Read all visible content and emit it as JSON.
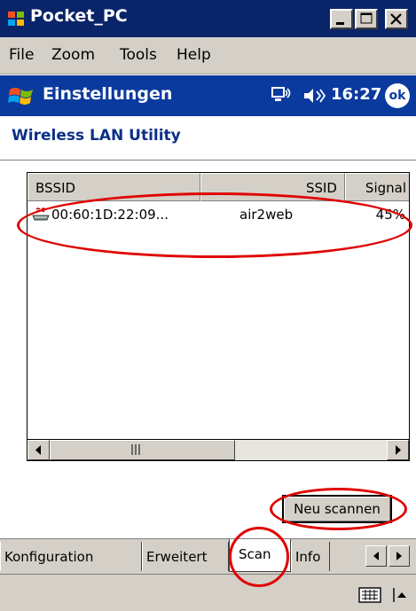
{
  "window": {
    "title": "Pocket_PC",
    "controls": {
      "minimize": "_",
      "maximize": "□",
      "close": "✕"
    }
  },
  "menu": {
    "file": "File",
    "zoom": "Zoom",
    "tools": "Tools",
    "help": "Help"
  },
  "navbar": {
    "title": "Einstellungen",
    "time": "16:27",
    "ok_label": "ok",
    "icons": [
      "windows-start-icon",
      "connectivity-icon",
      "speaker-icon"
    ]
  },
  "page": {
    "title": "Wireless LAN Utility"
  },
  "list": {
    "columns": [
      "BSSID",
      "SSID",
      "Signal"
    ],
    "rows": [
      {
        "bssid": "00:60:1D:22:09...",
        "ssid": "air2web",
        "signal": "45%"
      }
    ]
  },
  "buttons": {
    "rescan": "Neu scannen"
  },
  "tabs": [
    {
      "label": "Konfiguration",
      "active": false
    },
    {
      "label": "Erweitert",
      "active": false
    },
    {
      "label": "Scan",
      "active": true
    },
    {
      "label": "Info",
      "active": false
    }
  ],
  "colors": {
    "title_bar": "#0a246a",
    "nav_bar": "#0b3a9e",
    "chrome": "#d4d0c8",
    "page_title": "#0b2f88",
    "annotation": "#e00000"
  }
}
